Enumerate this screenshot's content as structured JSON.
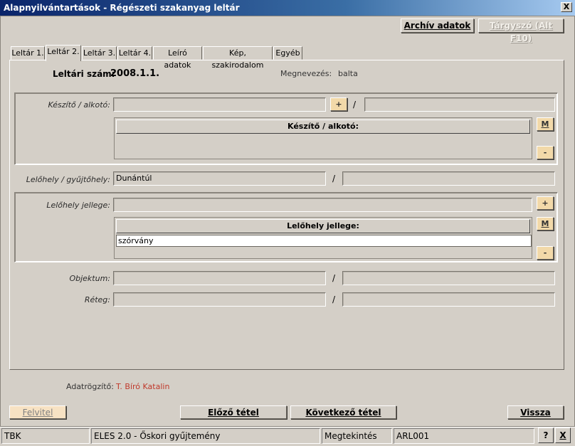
{
  "window": {
    "title": "Alapnyilvántartások - Régészeti szakanyag leltár",
    "close_label": "X"
  },
  "toolbar": {
    "archive_label": "Archív adatok",
    "subject_label": "Tárgyszó (Alt F10)"
  },
  "tabs": [
    {
      "label": "Leltár 1.",
      "active": false
    },
    {
      "label": "Leltár 2.",
      "active": true
    },
    {
      "label": "Leltár 3.",
      "active": false
    },
    {
      "label": "Leltár 4.",
      "active": false
    },
    {
      "label": "Leíró adatok",
      "active": false
    },
    {
      "label": "Kép, szakirodalom",
      "active": false
    },
    {
      "label": "Egyéb",
      "active": false
    }
  ],
  "header": {
    "inventory_label": "Leltári szám:",
    "inventory_value": "2008.1.1.",
    "name_label": "Megnevezés:",
    "name_value": "balta"
  },
  "creator": {
    "label": "Készítő / alkotó:",
    "value": "",
    "value2": "",
    "separator": "/",
    "add_label": "+",
    "list_header": "Készítő / alkotó:",
    "m_label": "M",
    "minus_label": "-"
  },
  "site": {
    "label": "Lelőhely / gyűjtőhely:",
    "value": "Dunántúl",
    "value2": "",
    "separator": "/"
  },
  "site_type": {
    "label": "Lelőhely jellege:",
    "value": "",
    "add_label": "+",
    "list_header": "Lelőhely jellege:",
    "items": [
      "szórvány"
    ],
    "m_label": "M",
    "minus_label": "-"
  },
  "object": {
    "label": "Objektum:",
    "value": "",
    "value2": "",
    "separator": "/"
  },
  "layer": {
    "label": "Réteg:",
    "value": "",
    "value2": "",
    "separator": "/"
  },
  "recorder": {
    "label": "Adatrögzítő:",
    "value": "T. Bíró Katalin",
    "color": "#c0392b"
  },
  "footer": {
    "new_label": "Felvitel",
    "prev_label": "Előző tétel",
    "next_label": "Következő tétel",
    "back_label": "Vissza"
  },
  "status": {
    "cell1": "TBK",
    "cell2": "ELES 2.0 - Őskori gyűjtemény",
    "cell3": "Megtekintés",
    "cell4": "ARL001",
    "help_label": "?",
    "close_label": "X"
  }
}
